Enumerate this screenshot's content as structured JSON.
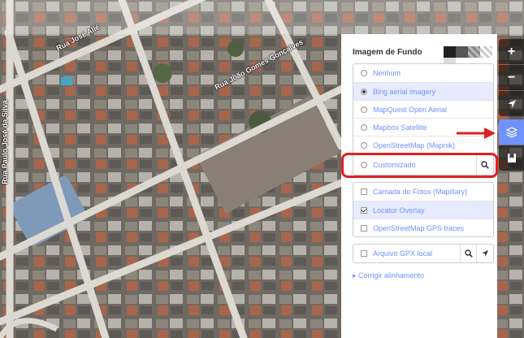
{
  "map": {
    "streets": [
      "Rua José Allé",
      "Rua João Gomes Gonçalves",
      "Rua Paulo José da Silva"
    ]
  },
  "background_panel": {
    "title": "Imagem de Fundo",
    "backgrounds": [
      {
        "label": "Nenhum",
        "selected": false
      },
      {
        "label": "Bing aerial imagery",
        "selected": true
      },
      {
        "label": "MapQuest Open Aerial",
        "selected": false
      },
      {
        "label": "Mapbox Satellite",
        "selected": false
      },
      {
        "label": "OpenStreetMap (Mapnik)",
        "selected": false
      }
    ],
    "custom": {
      "label": "Customizado",
      "selected": false
    },
    "overlays": [
      {
        "label": "Camada de Fotos (Mapillary)",
        "checked": false
      },
      {
        "label": "Locator Overlay",
        "checked": true
      },
      {
        "label": "OpenStreetMap GPS traces",
        "checked": false
      }
    ],
    "gpx": {
      "label": "Arquivo GPX local",
      "checked": false
    },
    "fix_alignment": "▸ Corrigir alinhamento"
  },
  "toolbar": {
    "zoom_in": "+",
    "zoom_out": "−",
    "icons": [
      "plus-icon",
      "minus-icon",
      "locate-arrow-icon",
      "layers-icon",
      "map-data-icon"
    ]
  },
  "colors": {
    "accent": "#7092ff",
    "highlight": "#e02020",
    "active_row": "#e8ebff"
  }
}
